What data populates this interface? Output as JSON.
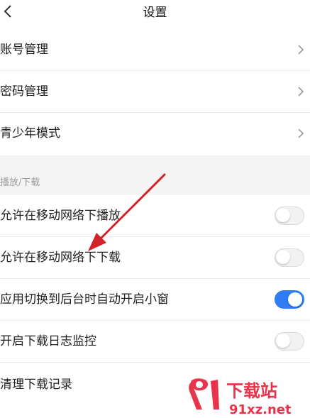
{
  "header": {
    "title": "设置",
    "back_icon": "chevron-left-icon"
  },
  "account_group": {
    "items": [
      {
        "label": "账号管理",
        "icon": "chevron-right-icon"
      },
      {
        "label": "密码管理",
        "icon": "chevron-right-icon"
      },
      {
        "label": "青少年模式",
        "icon": "chevron-right-icon"
      }
    ]
  },
  "playback_section": {
    "title": "播放/下载",
    "items": [
      {
        "label": "允许在移动网络下播放",
        "toggle": false
      },
      {
        "label": "允许在移动网络下下载",
        "toggle": false
      },
      {
        "label": "应用切换到后台时自动开启小窗",
        "toggle": true
      },
      {
        "label": "开启下载日志监控",
        "toggle": false
      },
      {
        "label": "清理下载记录"
      }
    ]
  },
  "colors": {
    "toggle_on": "#2f7df6",
    "toggle_off": "#f2f2f2",
    "annotation_arrow": "#d2232a",
    "section_bg": "#f4f4f4"
  },
  "watermark": {
    "logo_text": "下载站",
    "url_text": "91xz.net"
  }
}
